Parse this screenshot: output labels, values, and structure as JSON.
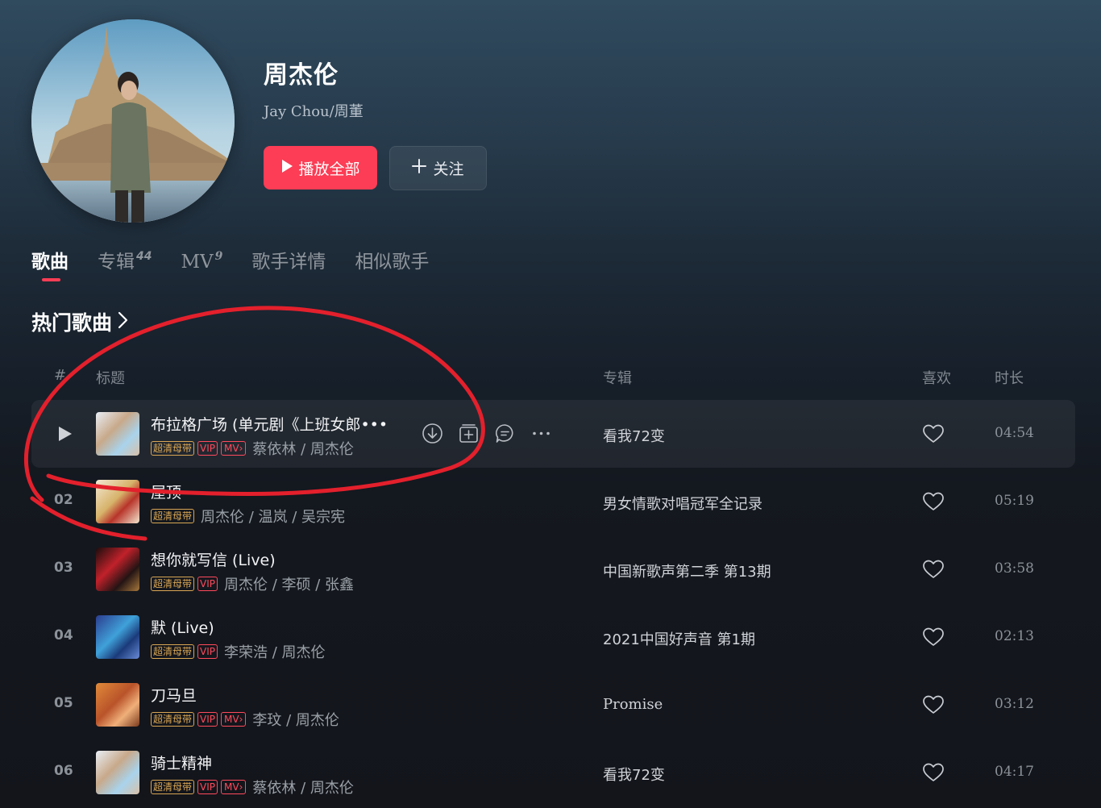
{
  "artist": {
    "name": "周杰伦",
    "alias": "Jay Chou/周董"
  },
  "buttons": {
    "play_all": "播放全部",
    "follow": "关注"
  },
  "tabs": [
    {
      "label": "歌曲",
      "count": ""
    },
    {
      "label": "专辑",
      "count": "44"
    },
    {
      "label": "MV",
      "count": "9"
    },
    {
      "label": "歌手详情",
      "count": ""
    },
    {
      "label": "相似歌手",
      "count": ""
    }
  ],
  "section": {
    "title": "热门歌曲"
  },
  "table_header": {
    "index": "#",
    "title": "标题",
    "album": "专辑",
    "like": "喜欢",
    "duration": "时长"
  },
  "tags": {
    "sq": "超清母带",
    "vip": "VIP",
    "mv": "MV"
  },
  "songs": [
    {
      "index": "",
      "title": "布拉格广场 (单元剧《上班女郎•••",
      "artists": "蔡依林 / 周杰伦",
      "album": "看我72变",
      "duration": "04:54",
      "vip": true,
      "mv": true
    },
    {
      "index": "02",
      "title": "屋顶",
      "artists": "周杰伦 / 温岚 / 吴宗宪",
      "album": "男女情歌对唱冠军全记录",
      "duration": "05:19",
      "vip": false,
      "mv": false
    },
    {
      "index": "03",
      "title": "想你就写信 (Live)",
      "artists": "周杰伦 / 李硕 / 张鑫",
      "album": "中国新歌声第二季 第13期",
      "duration": "03:58",
      "vip": true,
      "mv": false
    },
    {
      "index": "04",
      "title": "默 (Live)",
      "artists": "李荣浩 / 周杰伦",
      "album": "2021中国好声音 第1期",
      "duration": "02:13",
      "vip": true,
      "mv": false
    },
    {
      "index": "05",
      "title": "刀马旦",
      "artists": "李玟 / 周杰伦",
      "album": "Promise",
      "duration": "03:12",
      "vip": true,
      "mv": true
    },
    {
      "index": "06",
      "title": "骑士精神",
      "artists": "蔡依林 / 周杰伦",
      "album": "看我72变",
      "duration": "04:17",
      "vip": true,
      "mv": true
    }
  ],
  "colors": {
    "accent": "#fc3d55",
    "sq_tag": "#d9a654",
    "annotation": "#e3202c"
  }
}
